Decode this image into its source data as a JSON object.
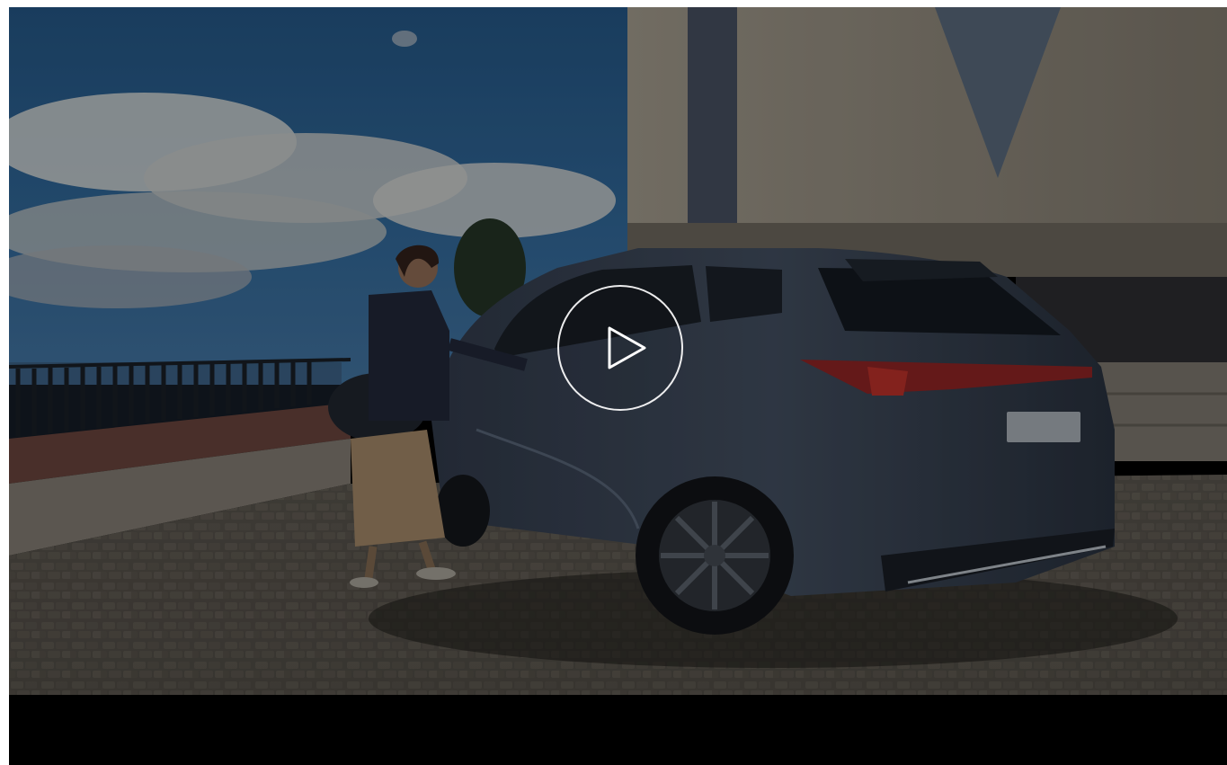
{
  "player": {
    "play_icon": "play-icon",
    "colors": {
      "letterbox": "#000000",
      "play_ring": "#ffffff"
    }
  }
}
